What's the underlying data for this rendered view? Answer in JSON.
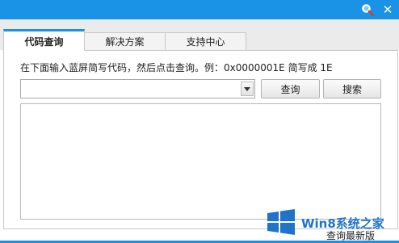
{
  "title_bar": {
    "search_icon": "magnifier-icon",
    "close_icon": "close-icon",
    "close_glyph": "✕",
    "bg_color": "#1a93e6"
  },
  "tabs": [
    {
      "label": "代码查询",
      "active": true
    },
    {
      "label": "解决方案",
      "active": false
    },
    {
      "label": "支持中心",
      "active": false
    }
  ],
  "main": {
    "instruction": "在下面输入蓝屏简写代码，然后点击查询。例：0x0000001E 简写成 1E",
    "code_input": {
      "value": "",
      "placeholder": ""
    },
    "query_button": "查询",
    "search_button": "搜索",
    "result_text": ""
  },
  "footer": {
    "update_link": "查询最新版"
  },
  "watermark": {
    "text": "Win8系统之家",
    "logo_color": "#1f73c9"
  }
}
